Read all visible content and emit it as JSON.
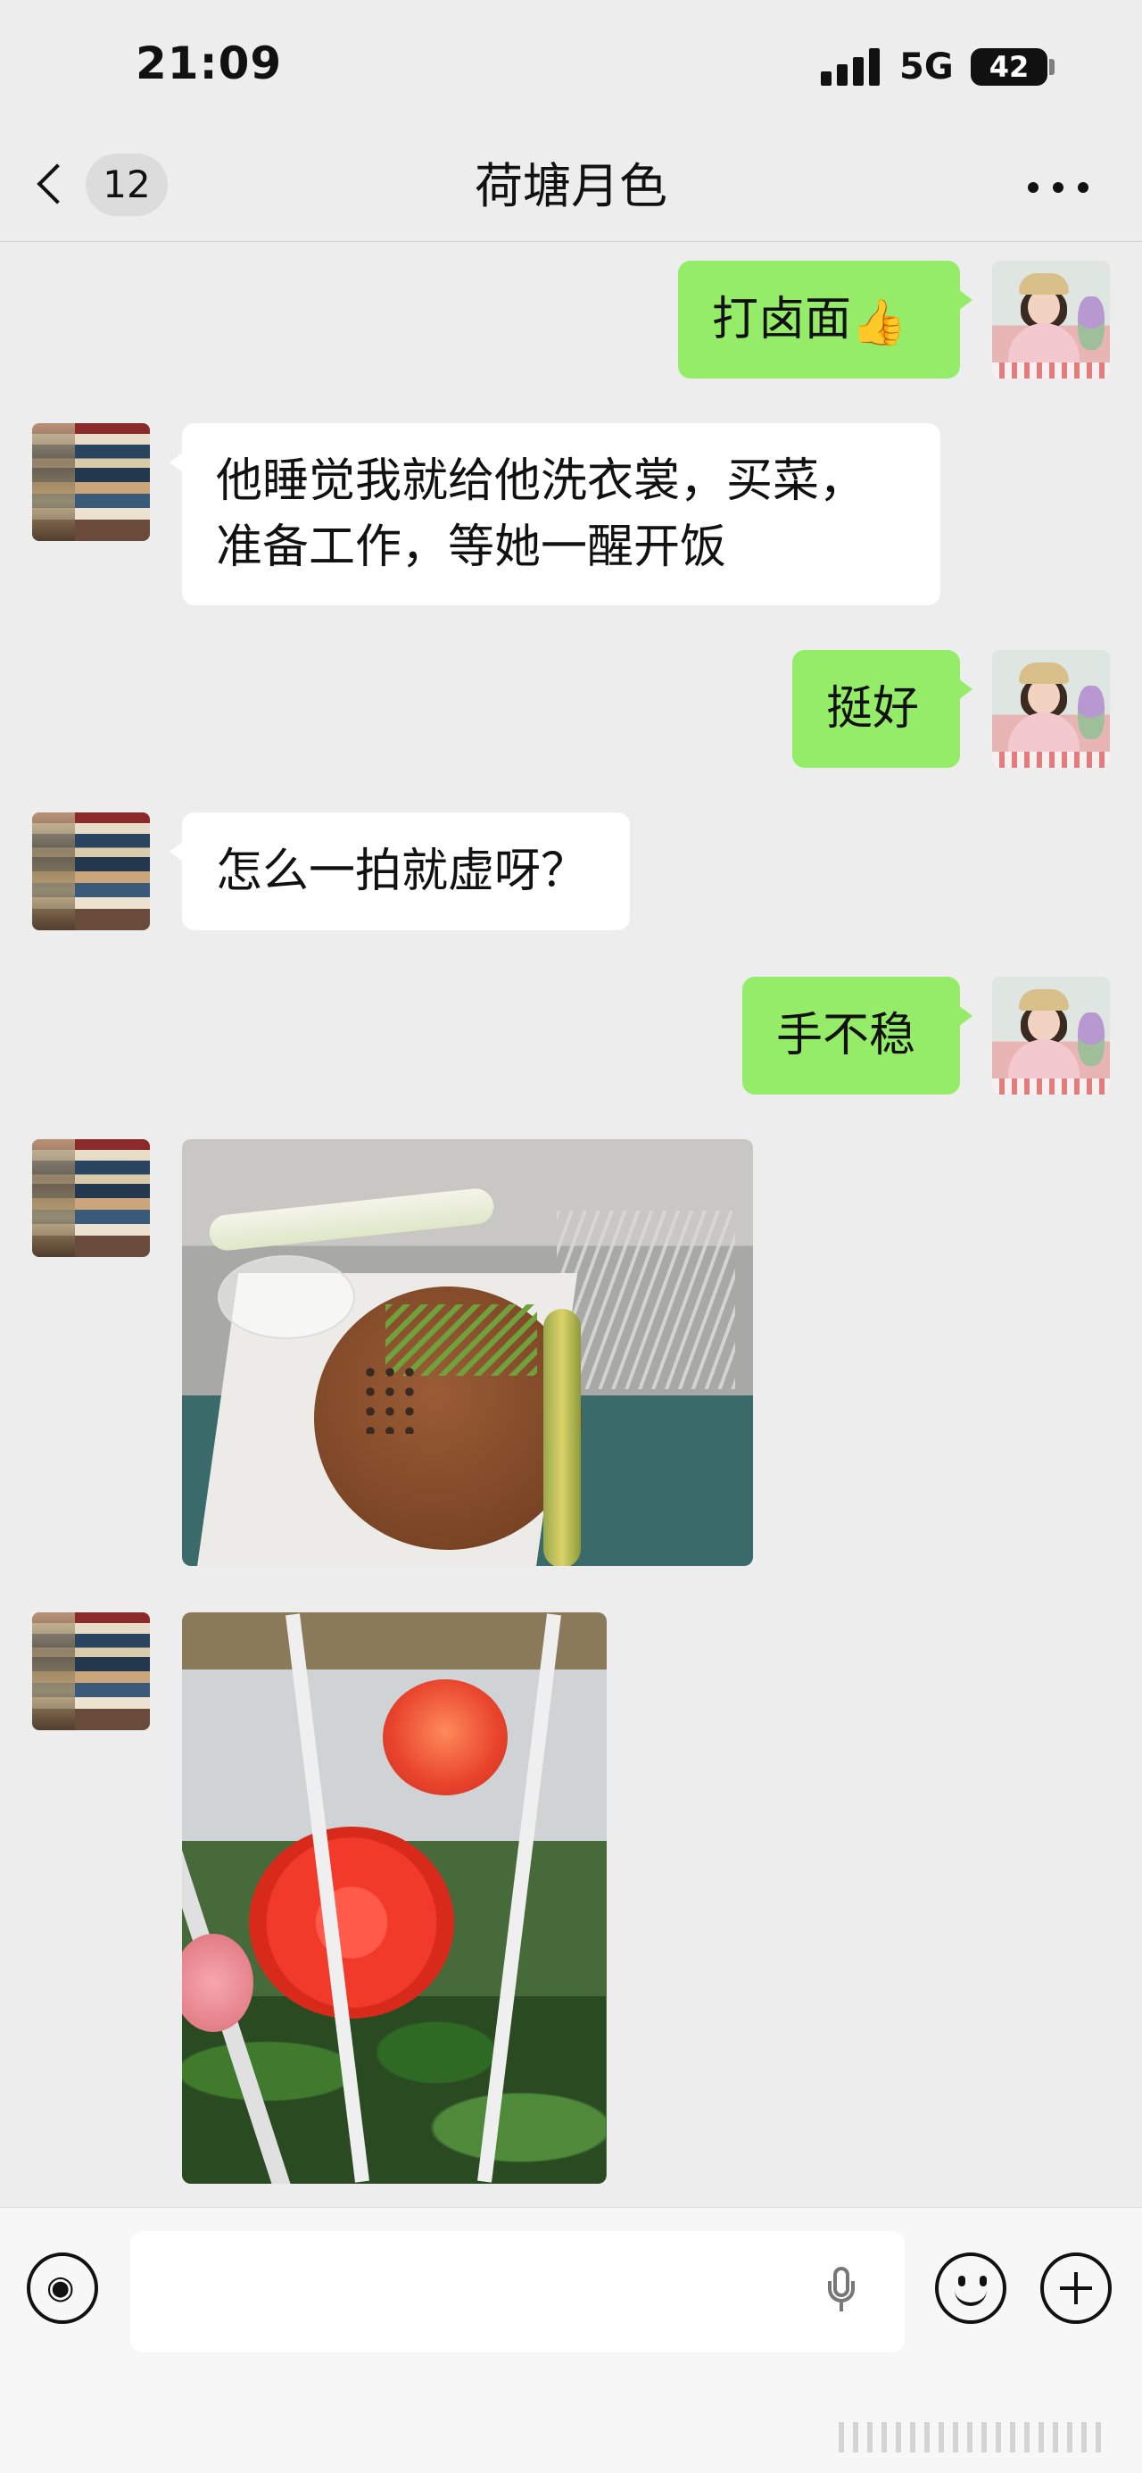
{
  "status_bar": {
    "time": "21:09",
    "network": "5G",
    "battery": "42"
  },
  "nav": {
    "unread_count": "12",
    "title": "荷塘月色"
  },
  "messages": [
    {
      "sender": "me",
      "text": "打卤面",
      "emoji": "👍"
    },
    {
      "sender": "them",
      "text_line1": "他睡觉我就给他洗衣裳，买菜，",
      "text_line2": "准备工作，等她一醒开饭"
    },
    {
      "sender": "me",
      "text": "挺好"
    },
    {
      "sender": "them",
      "text": "怎么一拍就虚呀？"
    },
    {
      "sender": "me",
      "text": "手不稳"
    },
    {
      "sender": "them",
      "type": "image",
      "icon": "food-prep-photo"
    },
    {
      "sender": "them",
      "type": "image",
      "icon": "rose-photo"
    }
  ],
  "input": {
    "value": "",
    "placeholder": ""
  }
}
